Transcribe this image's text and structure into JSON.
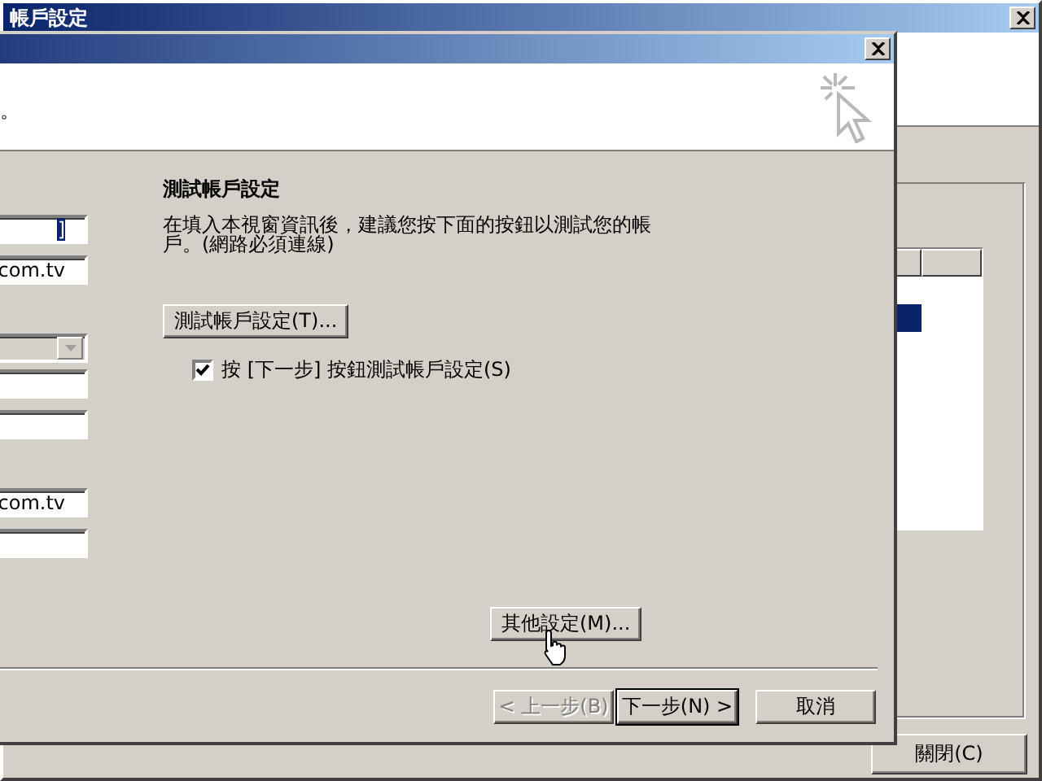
{
  "background_window": {
    "title": "帳戶設定",
    "list": {
      "rows": [
        {
          "selected": true
        }
      ]
    },
    "close_button": "關閉(C)"
  },
  "dialog": {
    "header_text": "。",
    "fields": [
      {
        "kind": "text",
        "value": "]",
        "highlighted": true
      },
      {
        "kind": "text",
        "value": "com.tv"
      },
      {
        "kind": "dropdown"
      },
      {
        "kind": "text"
      },
      {
        "kind": "text"
      },
      {
        "kind": "text",
        "value": "com.tv"
      },
      {
        "kind": "text"
      }
    ],
    "section_title": "測試帳戶設定",
    "description": "在填入本視窗資訊後，建議您按下面的按鈕以測試您的帳戶。(網路必須連線)",
    "test_button": "測試帳戶設定(T)...",
    "auto_test": {
      "label": "按 [下一步] 按鈕測試帳戶設定(S)",
      "checked": true
    },
    "more_button": "其他設定(M)...",
    "buttons": [
      {
        "label": "< 上一步(B)",
        "disabled": true,
        "default": false
      },
      {
        "label": "下一步(N) >",
        "disabled": false,
        "default": true
      },
      {
        "label": "取消",
        "disabled": false,
        "default": false
      }
    ]
  }
}
